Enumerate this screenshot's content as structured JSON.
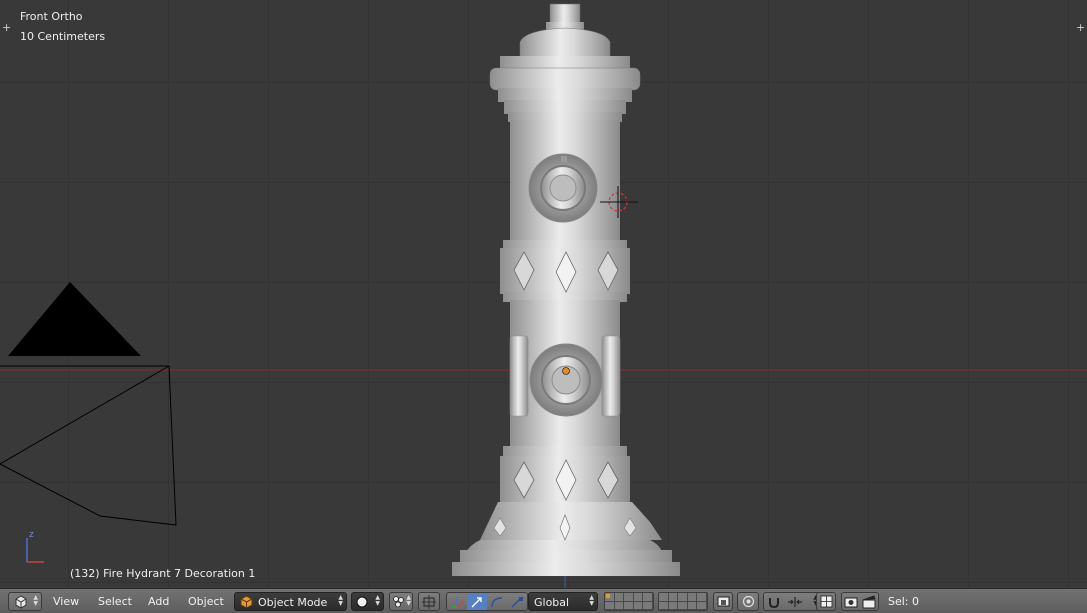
{
  "viewport": {
    "view_name": "Front Ortho",
    "scale_label": "10 Centimeters",
    "object_info": "(132) Fire Hydrant 7 Decoration 1",
    "axis_label": "z"
  },
  "header": {
    "editor_type_icon": "3d-view-icon",
    "menus": [
      "View",
      "Select",
      "Add",
      "Object"
    ],
    "mode": "Object Mode",
    "viewport_shading_icon": "solid-sphere-icon",
    "pivot_icon": "pivot-median-icon",
    "transform_orientation": "Global",
    "selection_status": "Sel: 0"
  },
  "colors": {
    "viewport_bg": "#393939",
    "grid_line": "#333333",
    "x_axis": "#8a2b2b",
    "header_bg": "#6b6b6b",
    "active_manipulator": "#5680c2",
    "mode_icon": "#e59a3a"
  }
}
